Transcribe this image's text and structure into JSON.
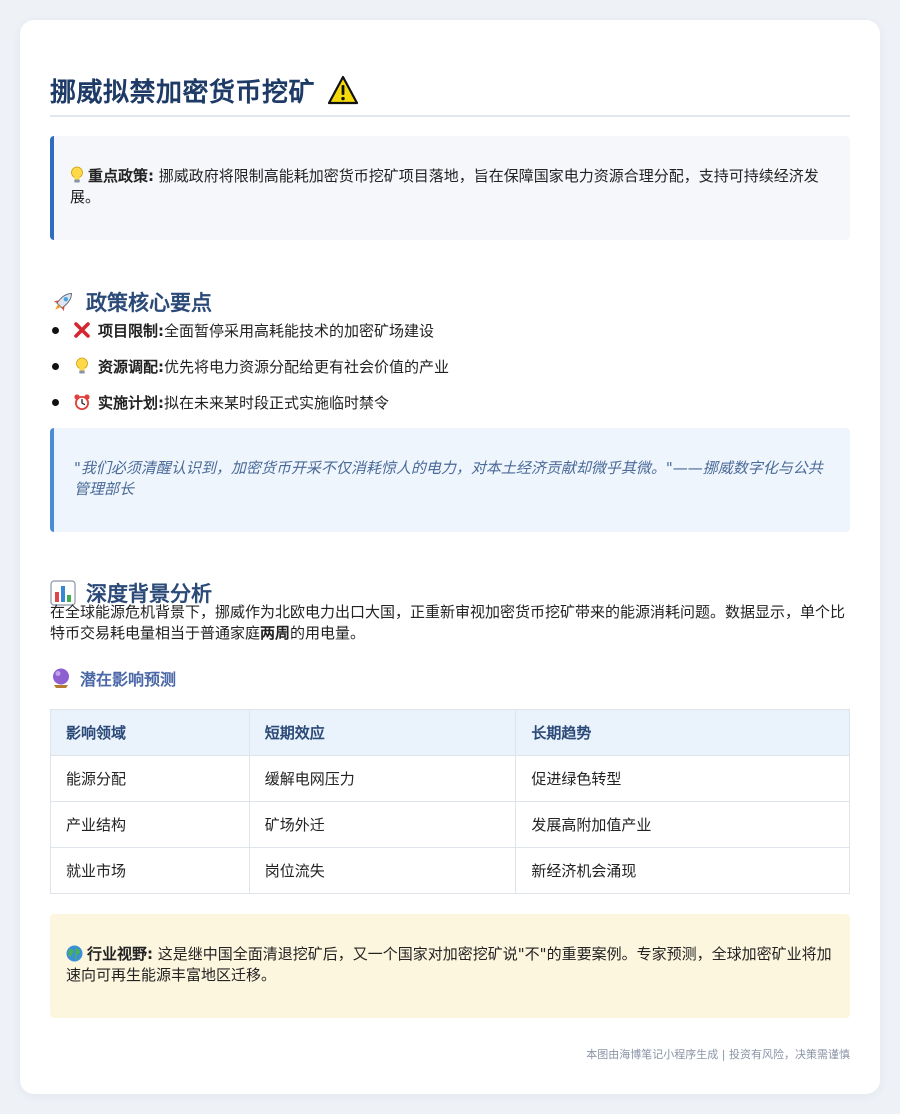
{
  "title": "挪威拟禁加密货币挖矿",
  "policy": {
    "label": "重点政策:",
    "text": " 挪威政府将限制高能耗加密货币挖矿项目落地，旨在保障国家电力资源合理分配，支持可持续经济发展。"
  },
  "core_section": {
    "heading": "政策核心要点",
    "points": [
      {
        "icon": "cross-mark-icon",
        "label": "项目限制:",
        "text": " 全面暂停采用高耗能技术的加密矿场建设"
      },
      {
        "icon": "light-bulb-icon",
        "label": "资源调配:",
        "text": " 优先将电力资源分配给更有社会价值的产业"
      },
      {
        "icon": "alarm-clock-icon",
        "label": "实施计划:",
        "text": " 拟在未来某时段正式实施临时禁令"
      }
    ]
  },
  "quote": "\"我们必须清醒认识到，加密货币开采不仅消耗惊人的电力，对本土经济贡献却微乎其微。\"——挪威数字化与公共管理部长",
  "background": {
    "heading": "深度背景分析",
    "para_before": "在全球能源危机背景下，挪威作为北欧电力出口大国，正重新审视加密货币挖矿带来的能源消耗问题。数据显示，单个比特币交易耗电量相当于普通家庭",
    "para_bold": "两周",
    "para_after": "的用电量。"
  },
  "impact": {
    "heading": "潜在影响预测",
    "columns": [
      "影响领域",
      "短期效应",
      "长期趋势"
    ],
    "rows": [
      [
        "能源分配",
        "缓解电网压力",
        "促进绿色转型"
      ],
      [
        "产业结构",
        "矿场外迁",
        "发展高附加值产业"
      ],
      [
        "就业市场",
        "岗位流失",
        "新经济机会涌现"
      ]
    ]
  },
  "industry": {
    "label": "行业视野:",
    "text": " 这是继中国全面清退挖矿后，又一个国家对加密挖矿说\"不\"的重要案例。专家预测，全球加密矿业将加速向可再生能源丰富地区迁移。"
  },
  "footer": "本图由海博笔记小程序生成 | 投资有风险，决策需谨慎",
  "colors": {
    "title": "#1e3a66",
    "accent_blue": "#2d6cc0",
    "quote_text": "#4a6a97",
    "table_header_bg": "#eaf3fc",
    "industry_bg": "#fdf6df"
  }
}
